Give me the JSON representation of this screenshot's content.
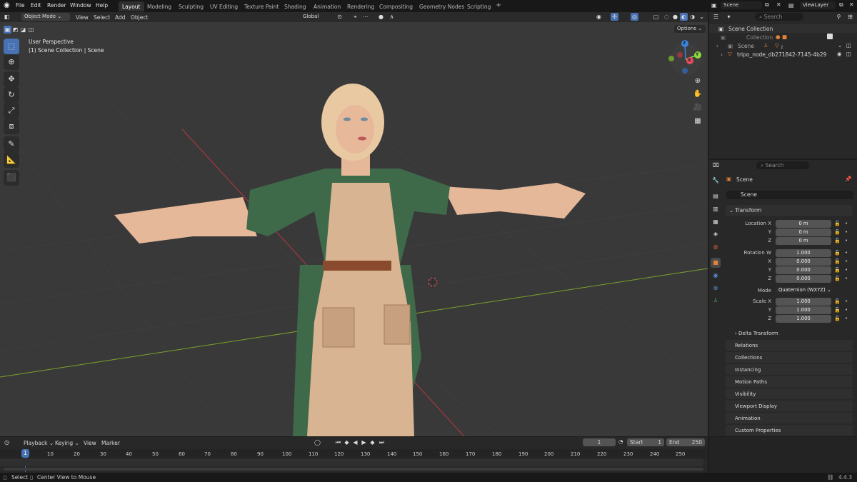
{
  "topmenu": [
    "File",
    "Edit",
    "Render",
    "Window",
    "Help"
  ],
  "workspaces": [
    "Layout",
    "Modeling",
    "Sculpting",
    "UV Editing",
    "Texture Paint",
    "Shading",
    "Animation",
    "Rendering",
    "Compositing",
    "Geometry Nodes",
    "Scripting"
  ],
  "active_workspace": "Layout",
  "scene_name": "Scene",
  "viewlayer_name": "ViewLayer",
  "viewport_header": {
    "mode": "Object Mode",
    "menus": [
      "View",
      "Select",
      "Add",
      "Object"
    ],
    "orientation": "Global",
    "options": "Options"
  },
  "viewport": {
    "perspective": "User Perspective",
    "collection_info": "(1) Scene Collection | Scene"
  },
  "gizmo": {
    "x": "X",
    "y": "Y",
    "z": "Z"
  },
  "search_placeholder": "Search",
  "outliner": {
    "root": "Scene Collection",
    "items": [
      {
        "label": "Collection"
      },
      {
        "label": "Scene",
        "badge": "2"
      },
      {
        "label": "tripo_node_db271842-7145-4b29-..."
      }
    ]
  },
  "properties": {
    "context": "Scene",
    "object_name": "Scene",
    "transform_title": "Transform",
    "location": {
      "label_x": "Location X",
      "label_y": "Y",
      "label_z": "Z",
      "x": "0 m",
      "y": "0 m",
      "z": "0 m"
    },
    "rotation": {
      "label_w": "Rotation W",
      "label_x": "X",
      "label_y": "Y",
      "label_z": "Z",
      "w": "1.000",
      "x": "0.000",
      "y": "0.000",
      "z": "0.000"
    },
    "mode_label": "Mode",
    "mode_value": "Quaternion (WXYZ)",
    "scale": {
      "label_x": "Scale X",
      "label_y": "Y",
      "label_z": "Z",
      "x": "1.000",
      "y": "1.000",
      "z": "1.000"
    },
    "delta": "Delta Transform",
    "panels": [
      "Relations",
      "Collections",
      "Instancing",
      "Motion Paths",
      "Visibility",
      "Viewport Display",
      "Animation",
      "Custom Properties"
    ]
  },
  "timeline": {
    "menus": [
      "Playback",
      "Keying",
      "View",
      "Marker"
    ],
    "current_frame": "1",
    "start_label": "Start",
    "start": "1",
    "end_label": "End",
    "end": "250",
    "ticks": [
      "10",
      "20",
      "30",
      "40",
      "50",
      "60",
      "70",
      "80",
      "90",
      "100",
      "110",
      "120",
      "130",
      "140",
      "150",
      "160",
      "170",
      "180",
      "190",
      "200",
      "210",
      "220",
      "230",
      "240",
      "250"
    ],
    "playhead": "1"
  },
  "statusbar": {
    "select": "Select",
    "center": "Center View to Mouse",
    "version": "4.4.3"
  },
  "colors": {
    "accent": "#4772b3",
    "x_axis": "#e84a5f",
    "y_axis": "#8bdb3c",
    "z_axis": "#3b86e0",
    "orange": "#e0823a"
  }
}
